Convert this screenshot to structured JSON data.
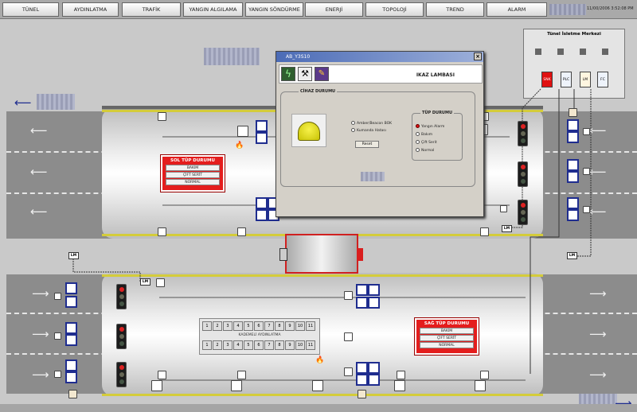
{
  "nav": [
    "TÜNEL",
    "AYDINLATMA",
    "TRAFİK",
    "YANGIN ALGILAMA",
    "YANGIN SÖNDÜRME",
    "ENERJİ",
    "TOPOLOJİ",
    "TREND",
    "ALARM"
  ],
  "datetime": "11/00/2006 3:52:08 PM",
  "control_center": {
    "title": "Tünel İsletme Merkezi",
    "units": [
      "SNK",
      "PLC",
      "LM",
      "FC"
    ]
  },
  "left_panel": {
    "title": "SOL TÜP DURUMU",
    "buttons": [
      "BAKIM",
      "ÇİFT SERİT",
      "NORMAL"
    ]
  },
  "right_panel": {
    "title": "SAĞ TÜP DURUMU",
    "buttons": [
      "BAKIM",
      "ÇİFT SERİT",
      "NORMAL"
    ]
  },
  "lm_label": "LM",
  "aydinlatma": {
    "label": "KADEMELİ AYDINLATMA",
    "top_cells": [
      "1",
      "2",
      "3",
      "4",
      "5",
      "6",
      "7",
      "8",
      "9",
      "10",
      "11"
    ],
    "bottom_cells": [
      "1",
      "2",
      "3",
      "4",
      "5",
      "6",
      "7",
      "8",
      "9",
      "10",
      "11"
    ]
  },
  "dialog": {
    "title": "AB_Y3S10",
    "header": "IKAZ LAMBASI",
    "group_title": "CİHAZ DURUMU",
    "options": [
      "Amber/Beacon BOK",
      "Kumanda Hatası"
    ],
    "reset": "Reset",
    "tup_title": "TÜP DURUMU",
    "tup_options": [
      "Yangın Alarm",
      "Bakım",
      "Çift Serit",
      "Normal"
    ]
  },
  "colors": {
    "panel": "#e41d1d",
    "accent": "#1f2d8f",
    "lamp": "#e8e30f",
    "title_bar": "#4b6bb6"
  },
  "icons": [
    "bolt-icon",
    "wrench-icon",
    "book-icon",
    "warning-lamp-icon",
    "fire-icon",
    "arrow-left-icon",
    "arrow-right-icon"
  ]
}
